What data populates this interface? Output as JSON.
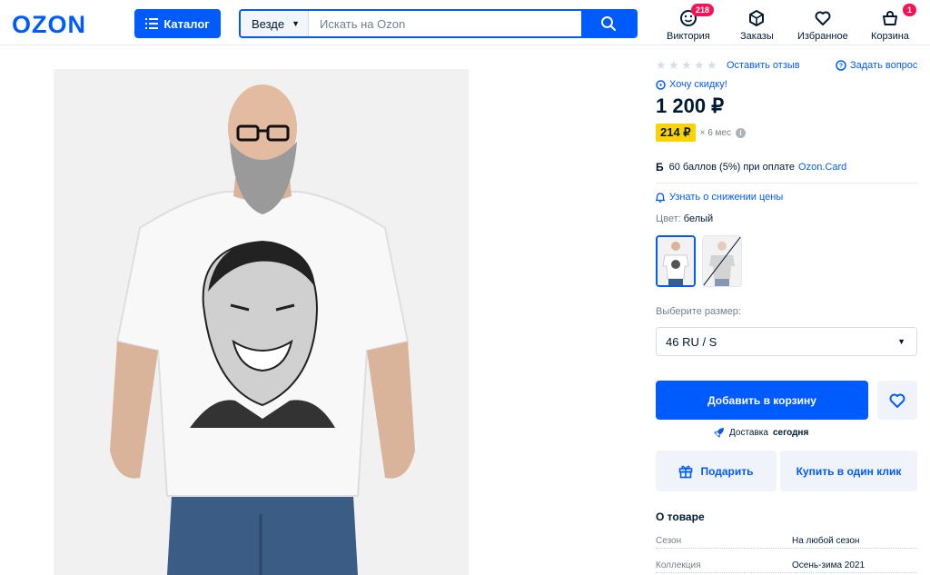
{
  "header": {
    "logo": "OZON",
    "catalog_label": "Каталог",
    "search_scope": "Везде",
    "search_placeholder": "Искать на Ozon",
    "nav": [
      {
        "label": "Виктория",
        "badge": "218",
        "icon": "smiley-icon"
      },
      {
        "label": "Заказы",
        "icon": "box-icon"
      },
      {
        "label": "Избранное",
        "icon": "heart-icon"
      },
      {
        "label": "Корзина",
        "badge": "1",
        "icon": "basket-icon"
      }
    ]
  },
  "product": {
    "rating_stars": 0,
    "review_link": "Оставить отзыв",
    "ask_question": "Задать вопрос",
    "discount_link": "Хочу скидку!",
    "price": "1 200 ₽",
    "installment_price": "214 ₽",
    "installment_term": "× 6 мес",
    "points_icon": "Б",
    "points_text": "60 баллов (5%) при оплате",
    "points_link": "Ozon.Card",
    "price_drop_link": "Узнать о снижении цены",
    "color_label": "Цвет:",
    "color_value": "белый",
    "size_label": "Выберите размер:",
    "size_value": "46 RU / S",
    "add_to_cart": "Добавить в корзину",
    "delivery_prefix": "Доставка",
    "delivery_when": "сегодня",
    "gift_button": "Подарить",
    "one_click_button": "Купить в один клик",
    "about_title": "О товаре",
    "specs": [
      {
        "key": "Сезон",
        "value": "На любой сезон"
      },
      {
        "key": "Коллекция",
        "value": "Осень-зима 2021"
      }
    ]
  },
  "colors": {
    "brand": "#005bff",
    "badge": "#f91155",
    "installment": "#ffd300"
  }
}
